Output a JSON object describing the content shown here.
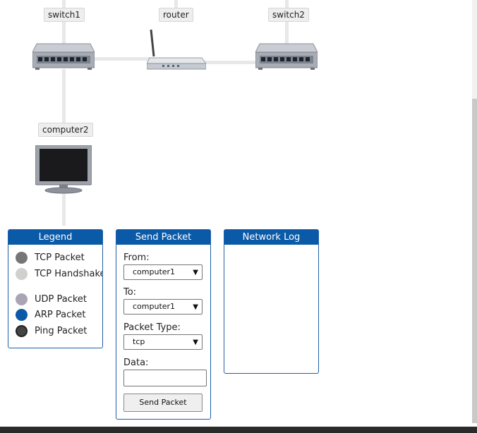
{
  "topology": {
    "nodes": [
      {
        "id": "switch1",
        "label": "switch1",
        "icon": "switch-icon"
      },
      {
        "id": "router",
        "label": "router",
        "icon": "router-icon"
      },
      {
        "id": "switch2",
        "label": "switch2",
        "icon": "switch-icon"
      },
      {
        "id": "computer2",
        "label": "computer2",
        "icon": "computer-monitor-icon"
      }
    ],
    "edges": [
      [
        "switch1",
        "router"
      ],
      [
        "router",
        "switch2"
      ],
      [
        "switch1",
        "computer2"
      ]
    ]
  },
  "legend": {
    "title": "Legend",
    "items": [
      {
        "label": "TCP Packet",
        "color": "#767676"
      },
      {
        "label": "TCP Handshake",
        "color": "#d0d0cc"
      },
      {
        "label": "UDP Packet",
        "color": "#aaa4b4"
      },
      {
        "label": "ARP Packet",
        "color": "#0e58a8"
      },
      {
        "label": "Ping Packet",
        "color": "#444444"
      }
    ]
  },
  "send_packet": {
    "title": "Send Packet",
    "from_label": "From:",
    "from_value": "computer1",
    "to_label": "To:",
    "to_value": "computer1",
    "type_label": "Packet Type:",
    "type_value": "tcp",
    "data_label": "Data:",
    "data_value": "",
    "button_label": "Send Packet"
  },
  "network_log": {
    "title": "Network Log",
    "entries": []
  },
  "colors": {
    "header_blue": "#0b5aa8",
    "panel_border": "#1f5ea8",
    "edge": "#e8e8e8"
  }
}
